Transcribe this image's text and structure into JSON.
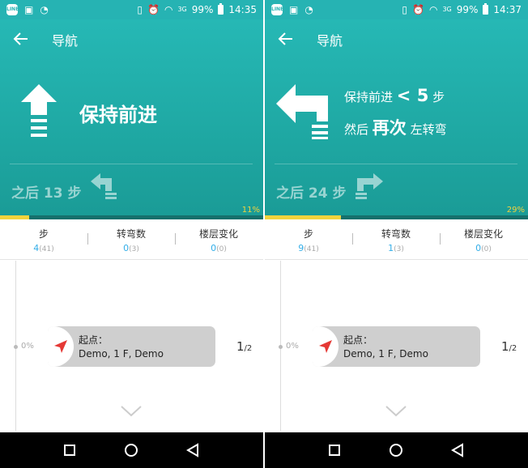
{
  "screens": [
    {
      "status": {
        "battery": "99%",
        "time": "14:35",
        "line_badge": "LINE",
        "net_badge": "3G"
      },
      "header": {
        "title": "导航"
      },
      "instruction": {
        "type": "single",
        "text": "保持前进"
      },
      "next": {
        "text": "之后 13 步"
      },
      "progress": {
        "percent": 11,
        "label": "11%"
      },
      "stats": [
        {
          "label": "步",
          "value": "4",
          "total": "(41)"
        },
        {
          "label": "转弯数",
          "value": "0",
          "total": "(3)"
        },
        {
          "label": "楼层变化",
          "value": "0",
          "total": "(0)"
        }
      ],
      "timeline": {
        "percent_label": "0%"
      },
      "card": {
        "title": "起点：",
        "subtitle": "Demo, 1 F, Demo"
      },
      "page": {
        "current": "1",
        "total": "/2"
      }
    },
    {
      "status": {
        "battery": "99%",
        "time": "14:37",
        "line_badge": "LINE",
        "net_badge": "3G"
      },
      "header": {
        "title": "导航"
      },
      "instruction": {
        "type": "double",
        "line1_pre": "保持前进",
        "line1_bold": "< 5",
        "line1_post": "步",
        "line2_pre": "然后",
        "line2_bold": "再次",
        "line2_post": "左转弯"
      },
      "next": {
        "text": "之后 24 步"
      },
      "progress": {
        "percent": 29,
        "label": "29%"
      },
      "stats": [
        {
          "label": "步",
          "value": "9",
          "total": "(41)"
        },
        {
          "label": "转弯数",
          "value": "1",
          "total": "(3)"
        },
        {
          "label": "楼层变化",
          "value": "0",
          "total": "(0)"
        }
      ],
      "timeline": {
        "percent_label": "0%"
      },
      "card": {
        "title": "起点：",
        "subtitle": "Demo, 1 F, Demo"
      },
      "page": {
        "current": "1",
        "total": "/2"
      }
    }
  ],
  "colors": {
    "header_teal": "#26b3b3",
    "progress_yellow": "#f1d33e",
    "stat_blue": "#33aee8",
    "card_gray": "#cfcfcf",
    "nav_arrow_red": "#e53935"
  },
  "icons": {
    "back": "arrow-left-icon",
    "straight": "arrow-up-steps-icon",
    "turn_left": "arrow-turn-left-icon",
    "turn_right": "arrow-turn-right-icon",
    "location": "navigation-pointer-icon",
    "expand": "chevron-down-icon",
    "nav_recent": "square-icon",
    "nav_home": "circle-icon",
    "nav_back": "triangle-back-icon"
  }
}
